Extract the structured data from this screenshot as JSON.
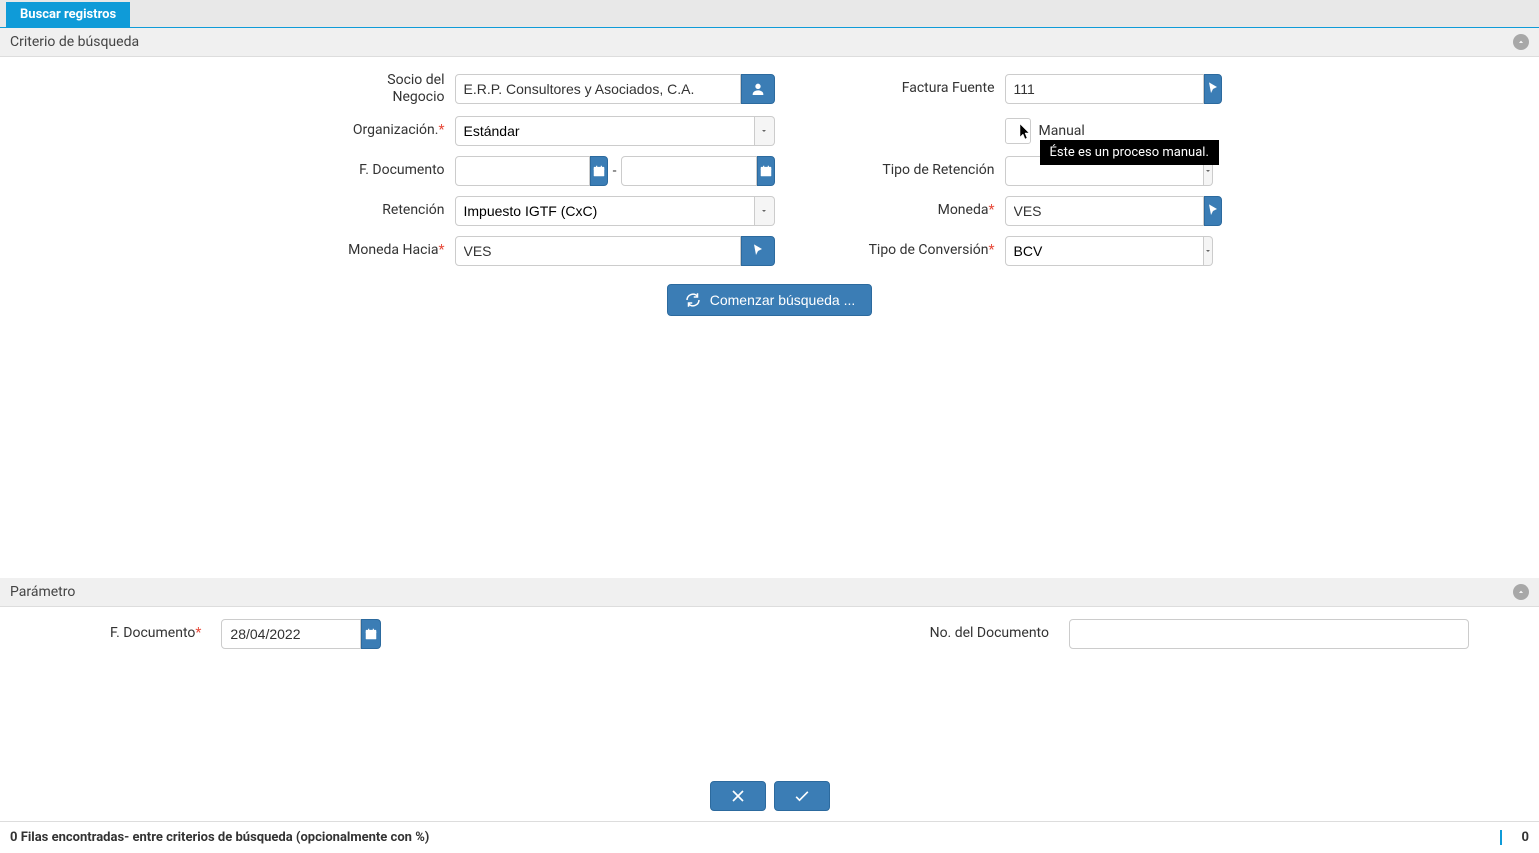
{
  "tab": {
    "title": "Buscar registros"
  },
  "criteria": {
    "header": "Criterio de búsqueda",
    "labels": {
      "socio": "Socio del Negocio",
      "factura": "Factura Fuente",
      "organizacion": "Organización.",
      "manual": "Manual",
      "f_documento": "F. Documento",
      "tipo_retencion": "Tipo de Retención",
      "retencion": "Retención",
      "moneda": "Moneda",
      "moneda_hacia": "Moneda Hacia",
      "tipo_conversion": "Tipo de Conversión"
    },
    "values": {
      "socio": "E.R.P. Consultores y Asociados, C.A.",
      "factura": "111",
      "organizacion": "Estándar",
      "tipo_retencion": "",
      "retencion": "Impuesto IGTF (CxC)",
      "moneda": "VES",
      "moneda_hacia": "VES",
      "tipo_conversion": "BCV",
      "f_documento_from": "",
      "f_documento_to": ""
    },
    "tooltip": "Éste es un proceso manual.",
    "search_button": "Comenzar búsqueda ..."
  },
  "parametro": {
    "header": "Parámetro",
    "labels": {
      "f_documento": "F. Documento",
      "no_documento": "No. del Documento"
    },
    "values": {
      "f_documento": "28/04/2022",
      "no_documento": ""
    }
  },
  "status": {
    "message": "0 Filas encontradas- entre criterios de búsqueda (opcionalmente con %)",
    "count": "0"
  }
}
